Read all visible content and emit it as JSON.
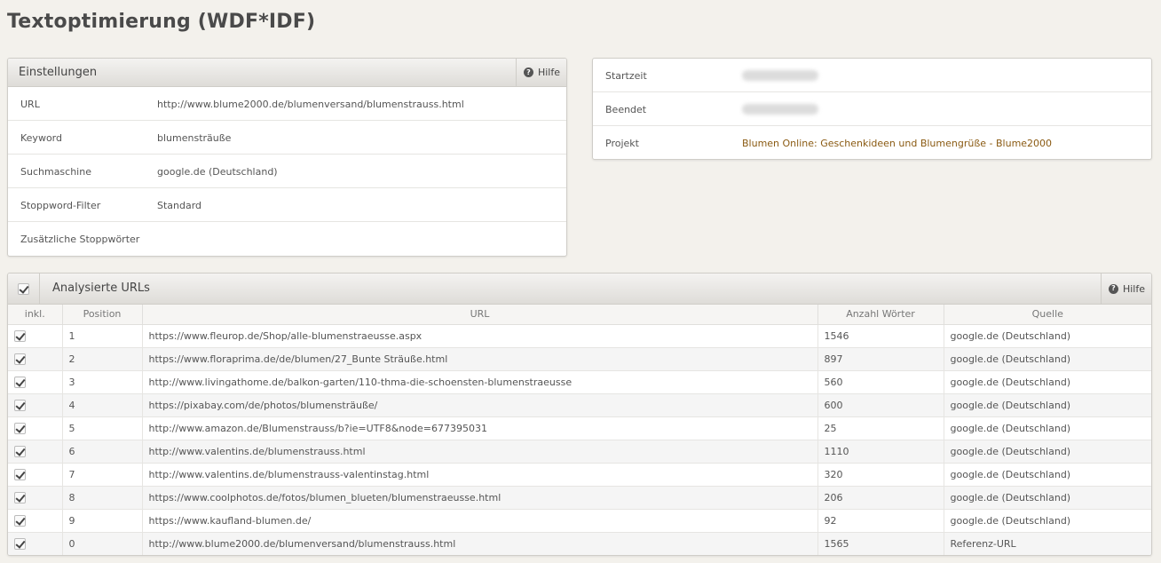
{
  "page_title": "Textoptimierung (WDF*IDF)",
  "settings": {
    "title": "Einstellungen",
    "help_label": "Hilfe",
    "rows": [
      {
        "key": "URL",
        "value": "http://www.blume2000.de/blumenversand/blumenstrauss.html"
      },
      {
        "key": "Keyword",
        "value": "blumensträuße"
      },
      {
        "key": "Suchmaschine",
        "value": "google.de (Deutschland)"
      },
      {
        "key": "Stoppword-Filter",
        "value": "Standard"
      },
      {
        "key": "Zusätzliche Stoppwörter",
        "value": ""
      }
    ]
  },
  "info": {
    "rows": [
      {
        "key": "Startzeit",
        "value": ""
      },
      {
        "key": "Beendet",
        "value": ""
      },
      {
        "key": "Projekt",
        "value": "Blumen Online: Geschenkideen und Blumengrüße - Blume2000"
      }
    ]
  },
  "analyzed": {
    "title": "Analysierte URLs",
    "help_label": "Hilfe",
    "columns": [
      "inkl.",
      "Position",
      "URL",
      "Anzahl Wörter",
      "Quelle"
    ],
    "rows": [
      {
        "position": "1",
        "url": "https://www.fleurop.de/Shop/alle-blumenstraeusse.aspx",
        "words": "1546",
        "source": "google.de (Deutschland)"
      },
      {
        "position": "2",
        "url": "https://www.floraprima.de/de/blumen/27_Bunte Sträuße.html",
        "words": "897",
        "source": "google.de (Deutschland)"
      },
      {
        "position": "3",
        "url": "http://www.livingathome.de/balkon-garten/110-thma-die-schoensten-blumenstraeusse",
        "words": "560",
        "source": "google.de (Deutschland)"
      },
      {
        "position": "4",
        "url": "https://pixabay.com/de/photos/blumensträuße/",
        "words": "600",
        "source": "google.de (Deutschland)"
      },
      {
        "position": "5",
        "url": "http://www.amazon.de/Blumenstrauss/b?ie=UTF8&node=677395031",
        "words": "25",
        "source": "google.de (Deutschland)"
      },
      {
        "position": "6",
        "url": "http://www.valentins.de/blumenstrauss.html",
        "words": "1110",
        "source": "google.de (Deutschland)"
      },
      {
        "position": "7",
        "url": "http://www.valentins.de/blumenstrauss-valentinstag.html",
        "words": "320",
        "source": "google.de (Deutschland)"
      },
      {
        "position": "8",
        "url": "https://www.coolphotos.de/fotos/blumen_blueten/blumenstraeusse.html",
        "words": "206",
        "source": "google.de (Deutschland)"
      },
      {
        "position": "9",
        "url": "https://www.kaufland-blumen.de/",
        "words": "92",
        "source": "google.de (Deutschland)"
      },
      {
        "position": "0",
        "url": "http://www.blume2000.de/blumenversand/blumenstrauss.html",
        "words": "1565",
        "source": "Referenz-URL"
      }
    ]
  }
}
